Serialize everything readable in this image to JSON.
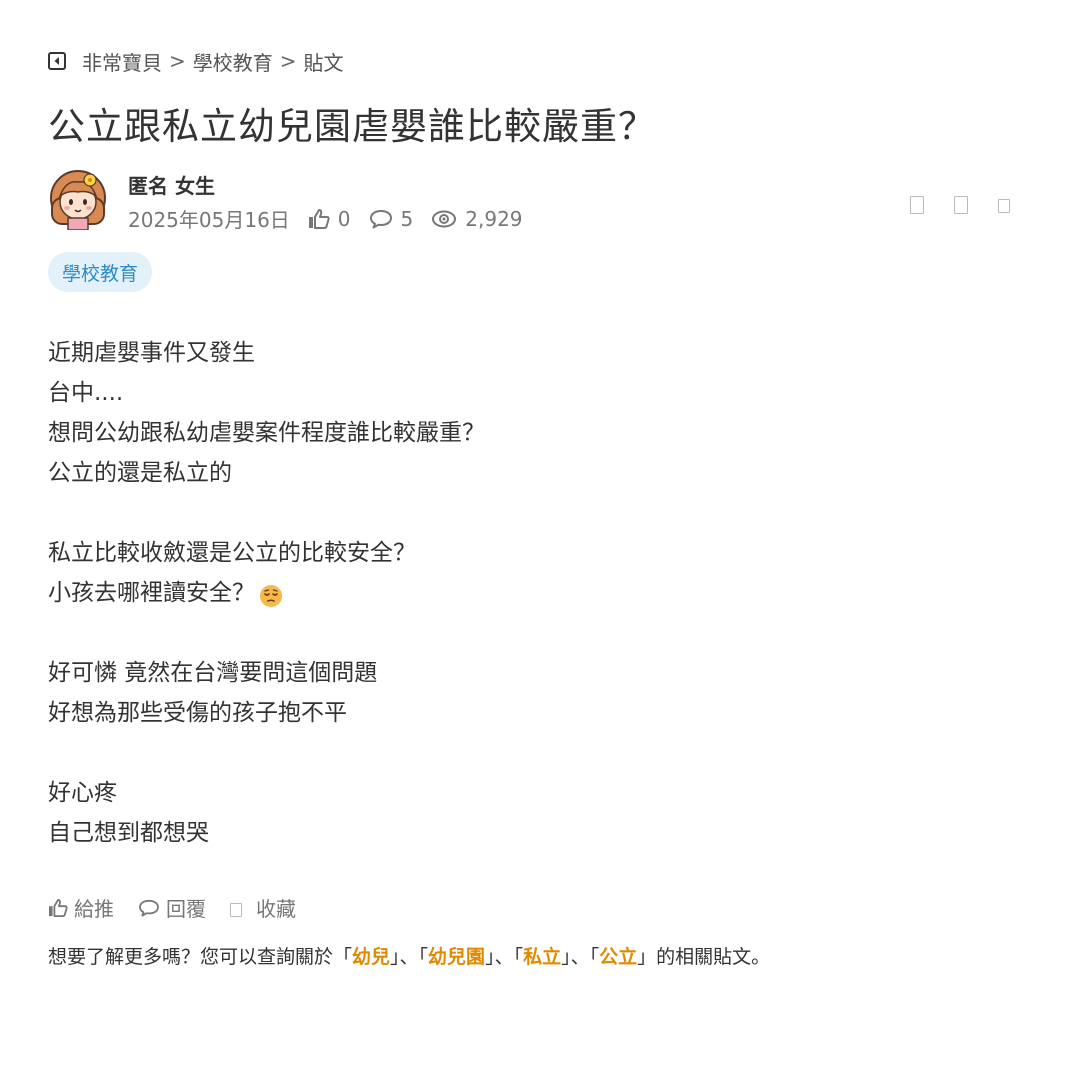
{
  "breadcrumb": {
    "items": [
      "非常寶貝",
      "學校教育",
      "貼文"
    ],
    "separator": ">"
  },
  "post": {
    "title": "公立跟私立幼兒園虐嬰誰比較嚴重？",
    "author": "匿名 女生",
    "date": "2025年05月16日",
    "likes": "0",
    "replies": "5",
    "views": "2,929",
    "tag": "學校教育",
    "body_lines": [
      "近期虐嬰事件又發生",
      "台中....",
      "想問公幼跟私幼虐嬰案件程度誰比較嚴重？",
      "公立的還是私立的",
      "",
      "私立比較收斂還是公立的比較安全？",
      "小孩去哪裡讀安全？",
      "",
      "好可憐 竟然在台灣要問這個問題",
      "好想為那些受傷的孩子抱不平",
      "",
      "好心疼",
      "自己想到都想哭"
    ]
  },
  "actions": {
    "like": "給推",
    "reply": "回覆",
    "save": "收藏"
  },
  "related": {
    "prefix": "想要了解更多嗎？您可以查詢關於「",
    "keywords": [
      "幼兒",
      "幼兒園",
      "私立",
      "公立"
    ],
    "joiner": "」、「",
    "suffix": "」的相關貼文。"
  },
  "colors": {
    "keyword": "#e08a00",
    "tag_text": "#2e8bc7",
    "tag_bg": "#e3f1fb"
  }
}
